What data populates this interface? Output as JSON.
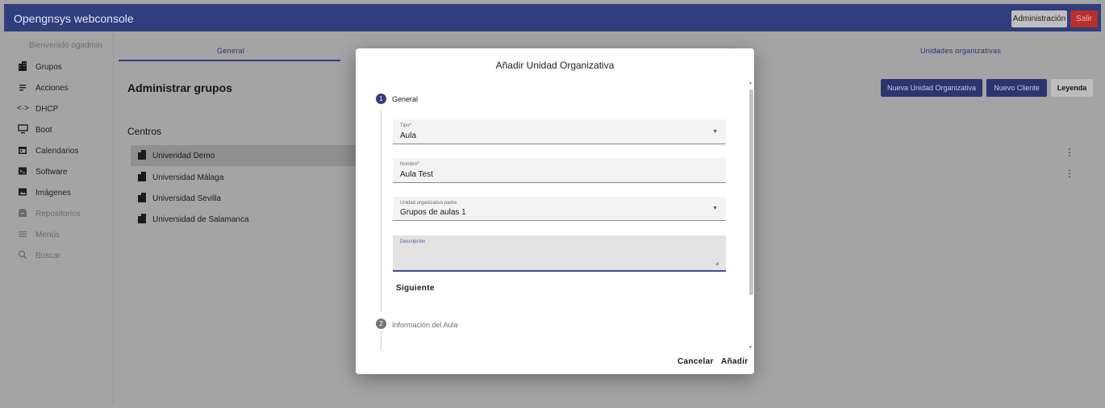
{
  "header": {
    "app_title": "Opengnsys webconsole",
    "admin_label": "Administración",
    "logout_label": "Salir"
  },
  "sidebar": {
    "welcome": "Bienvenido ogadmin",
    "items": [
      {
        "label": "Grupos",
        "icon": "building-icon"
      },
      {
        "label": "Acciones",
        "icon": "list-icon"
      },
      {
        "label": "DHCP",
        "icon": "code-arrows-icon"
      },
      {
        "label": "Boot",
        "icon": "monitor-icon"
      },
      {
        "label": "Calendarios",
        "icon": "calendar-icon"
      },
      {
        "label": "Software",
        "icon": "terminal-icon"
      },
      {
        "label": "Imágenes",
        "icon": "image-icon"
      },
      {
        "label": "Repositorios",
        "icon": "storage-icon"
      },
      {
        "label": "Menús",
        "icon": "menu-icon"
      },
      {
        "label": "Buscar",
        "icon": "search-icon"
      }
    ]
  },
  "main": {
    "tabs": [
      "General",
      "Unidades organizativas"
    ],
    "page_title": "Administrar grupos",
    "section_title": "Centros",
    "centers": [
      "Univeridad Demo",
      "Universidad Málaga",
      "Universidad Sevilla",
      "Universidad de Salamanca"
    ],
    "buttons": {
      "new_unit": "Nueva Unidad Organizativa",
      "new_client": "Nuevo Cliente",
      "legend": "Leyenda"
    }
  },
  "dialog": {
    "title": "Añadir Unidad Organizativa",
    "steps": [
      {
        "number": "1",
        "label": "General"
      },
      {
        "number": "2",
        "label": "Información del Aula"
      }
    ],
    "fields": {
      "tipo": {
        "label": "Tipo*",
        "value": "Aula"
      },
      "nombre": {
        "label": "Nombre*",
        "value": "Aula Test"
      },
      "parent": {
        "label": "Unidad organizativa padre",
        "value": "Grupos de aulas 1"
      },
      "descripcion": {
        "label": "Descripción",
        "value": ""
      }
    },
    "next_label": "Siguiente",
    "cancel_label": "Cancelar",
    "add_label": "Añadir"
  },
  "colors": {
    "primary": "#303e7e",
    "danger": "#b92f2f",
    "overlay": "#a4a4a4"
  }
}
